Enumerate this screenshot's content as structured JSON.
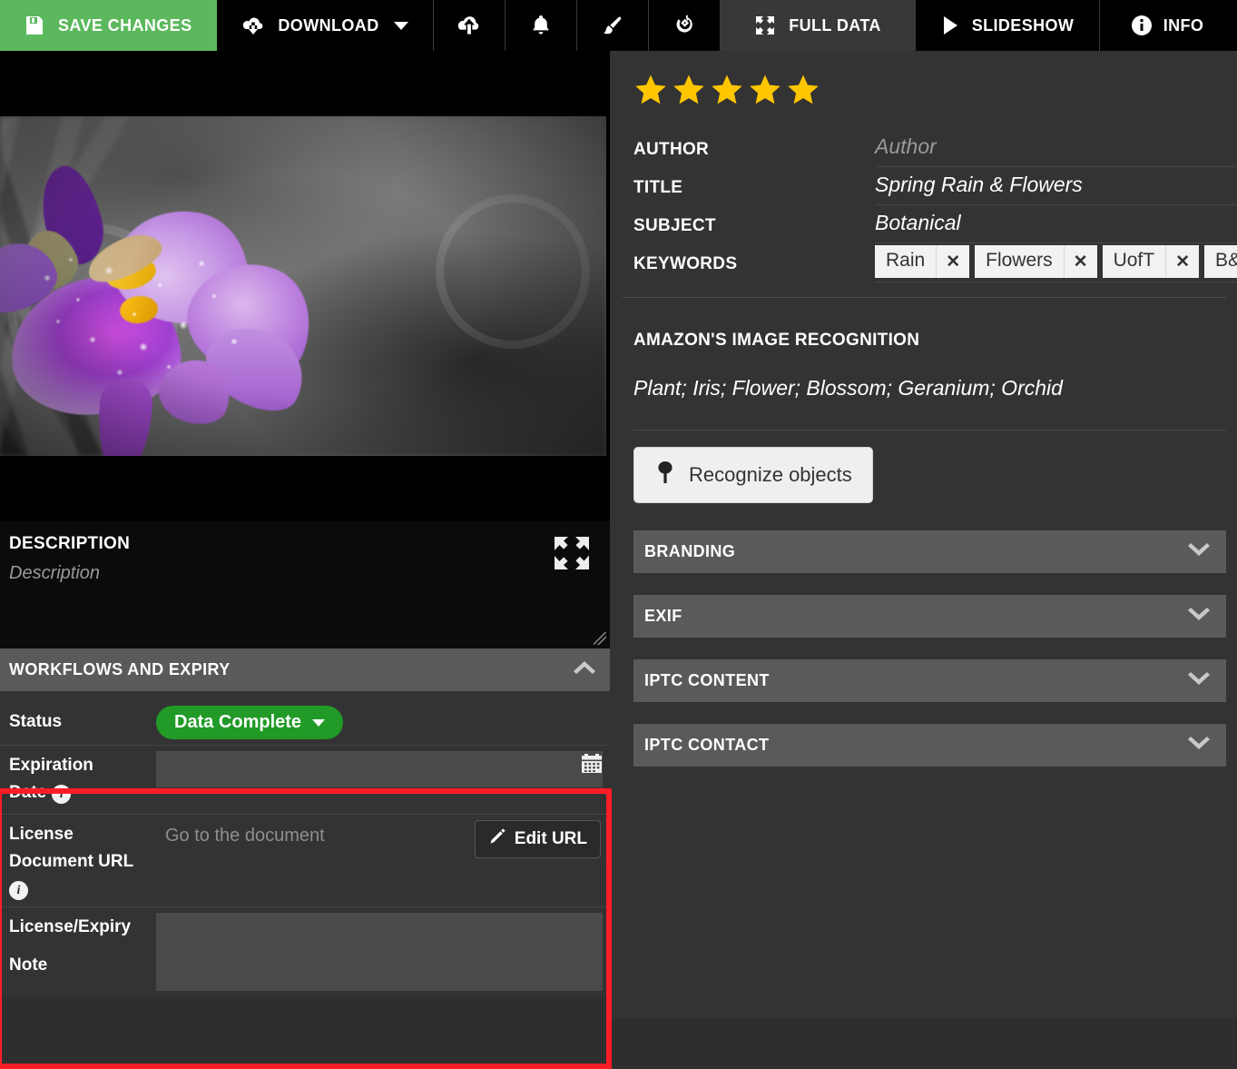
{
  "toolbar": {
    "save_label": "SAVE CHANGES",
    "save_icon": "floppy-save-icon",
    "download_label": "DOWNLOAD",
    "download_icon": "cloud-download-icon",
    "upload_icon": "cloud-upload-icon",
    "notify_icon": "bell-icon",
    "brush_icon": "paintbrush-icon",
    "rotate_icon": "rotate-crop-icon",
    "full_data_label": "FULL DATA",
    "full_data_icon": "expand-arrows-icon",
    "slideshow_label": "SLIDESHOW",
    "slideshow_icon": "play-icon",
    "info_label": "INFO",
    "info_icon": "info-circle-icon",
    "accent_green": "#5cb85c",
    "active_tab": "FULL DATA"
  },
  "preview": {
    "alt": "Purple iris flower with water droplets, grayscale background"
  },
  "description": {
    "label": "DESCRIPTION",
    "placeholder": "Description",
    "value": "",
    "expand_icon": "expand-arrows-icon"
  },
  "workflows": {
    "header": "WORKFLOWS AND EXPIRY",
    "collapse_icon": "chevron-up-icon",
    "status": {
      "label": "Status",
      "value": "Data Complete",
      "color": "#219a27",
      "caret_icon": "caret-down-icon"
    },
    "expiration": {
      "label_line1": "Expiration",
      "label_line2": "Date",
      "value": "",
      "calendar_icon": "calendar-icon",
      "info_icon": "info-icon"
    },
    "license_url": {
      "label_line1": "License",
      "label_line2": "Document URL",
      "link_text": "Go to the document",
      "button_label": "Edit URL",
      "button_icon": "pencil-icon",
      "info_icon": "info-icon"
    },
    "license_note": {
      "label_line1": "License/Expiry",
      "label_line2": "Note",
      "value": ""
    },
    "highlight_color": "#ff1d25"
  },
  "metadata": {
    "rating": {
      "stars_filled": 5,
      "stars_total": 5,
      "color": "#ffc600"
    },
    "fields": [
      {
        "label": "AUTHOR",
        "value": "Author",
        "is_placeholder": true
      },
      {
        "label": "TITLE",
        "value": "Spring Rain & Flowers",
        "is_placeholder": false
      },
      {
        "label": "SUBJECT",
        "value": "Botanical",
        "is_placeholder": false
      }
    ],
    "keywords_label": "KEYWORDS",
    "keywords": [
      "Rain",
      "Flowers",
      "UofT",
      "B&W"
    ],
    "keyword_remove_icon": "close-x-icon"
  },
  "recognition": {
    "title": "AMAZON'S IMAGE RECOGNITION",
    "tags": "Plant; Iris; Flower; Blossom; Geranium; Orchid",
    "button_label": "Recognize objects",
    "button_icon": "tree-icon"
  },
  "accordion": {
    "expand_icon": "chevron-down-icon",
    "sections": [
      {
        "label": "BRANDING"
      },
      {
        "label": "EXIF"
      },
      {
        "label": "IPTC CONTENT"
      },
      {
        "label": "IPTC CONTACT"
      }
    ]
  }
}
